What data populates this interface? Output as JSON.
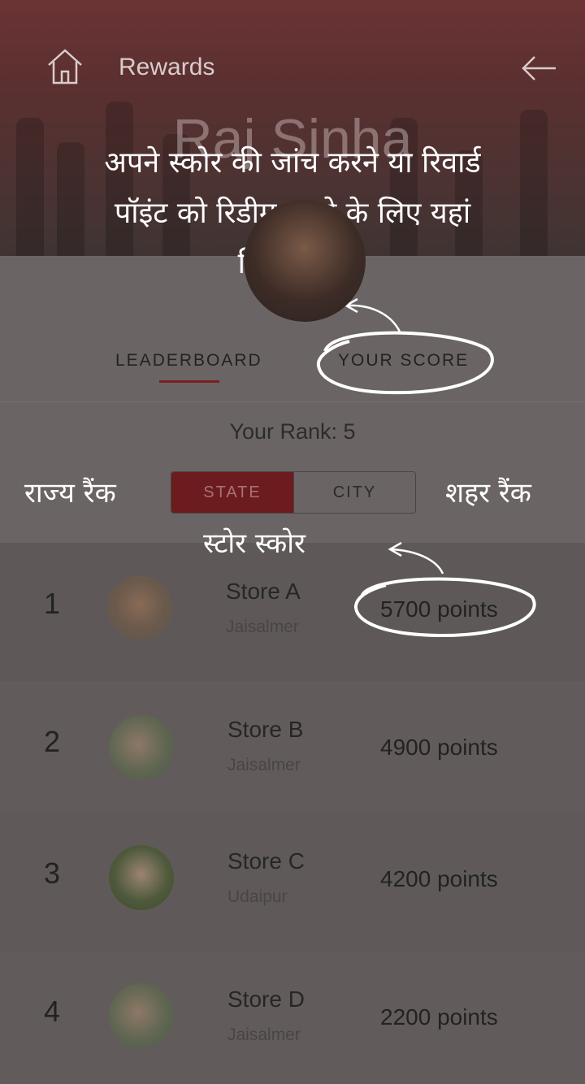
{
  "header": {
    "title": "Rewards",
    "profile_name": "Raj Sinha",
    "home_icon": "home-icon",
    "back_icon": "back-arrow-icon"
  },
  "tabs": [
    {
      "label": "LEADERBOARD",
      "active": true
    },
    {
      "label": "YOUR SCORE",
      "active": false
    }
  ],
  "rank_text": "Your Rank: 5",
  "segment": {
    "state_label": "STATE",
    "city_label": "CITY",
    "selected": "STATE"
  },
  "leaderboard": [
    {
      "rank": "1",
      "name": "Store A",
      "city": "Jaisalmer",
      "points": "5700 points"
    },
    {
      "rank": "2",
      "name": "Store B",
      "city": "Jaisalmer",
      "points": "4900 points"
    },
    {
      "rank": "3",
      "name": "Store C",
      "city": "Udaipur",
      "points": "4200 points"
    },
    {
      "rank": "4",
      "name": "Store D",
      "city": "Jaisalmer",
      "points": "2200 points"
    }
  ],
  "annotations": {
    "main": "अपने स्कोर की जांच करने या रिवार्ड पॉइंट को रिडीम करने के लिए यहां क्लिक करें",
    "state_rank": "राज्य रैंक",
    "city_rank": "शहर रैंक",
    "store_score": "स्टोर स्कोर"
  },
  "colors": {
    "accent": "#7a1f24",
    "segment_active": "#6c1b1e",
    "annotation": "#ffffff"
  }
}
